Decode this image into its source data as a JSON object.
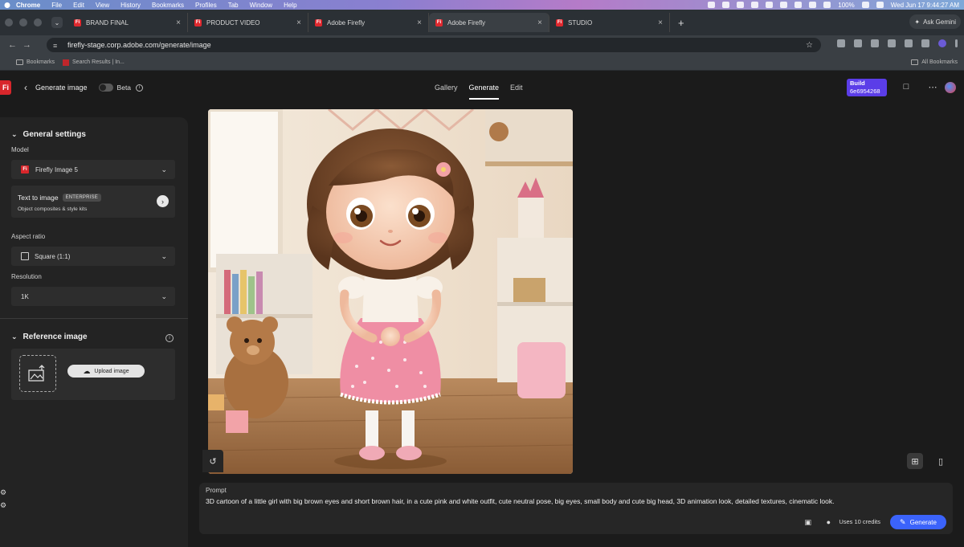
{
  "menubar": {
    "items": [
      "Chrome",
      "File",
      "Edit",
      "View",
      "History",
      "Bookmarks",
      "Profiles",
      "Tab",
      "Window",
      "Help"
    ],
    "battery": "100%",
    "clock": "Wed Jun 17  9:44:27 AM"
  },
  "tabs": [
    {
      "label": "BRAND FINAL"
    },
    {
      "label": "PRODUCT VIDEO"
    },
    {
      "label": "Adobe Firefly"
    },
    {
      "label": "Adobe Firefly"
    },
    {
      "label": "STUDIO"
    }
  ],
  "browser": {
    "ask_label": "Ask Gemini",
    "url": "firefly-stage.corp.adobe.com/generate/image",
    "bookmarks": {
      "folder": "Bookmarks",
      "search": "Search Results | In...",
      "all": "All Bookmarks"
    }
  },
  "header": {
    "logo": "Fi",
    "title": "Generate image",
    "beta": "Beta",
    "tabs": [
      "Gallery",
      "Generate",
      "Edit"
    ],
    "build_label": "Build",
    "build_id": "6e6954268"
  },
  "sidebar": {
    "general_title": "General settings",
    "model_label": "Model",
    "model_value": "Firefly Image 5",
    "card_title": "Text to image",
    "card_badge": "ENTERPRISE",
    "card_sub": "Object composites & style kits",
    "aspect_label": "Aspect ratio",
    "aspect_value": "Square (1:1)",
    "resolution_label": "Resolution",
    "resolution_value": "1K",
    "reference_title": "Reference image",
    "upload_label": "Upload image"
  },
  "prompt": {
    "label": "Prompt",
    "text": "3D cartoon of a little girl with big brown eyes and short brown hair, in a cute pink and white outfit, cute neutral pose, big eyes, small body and cute big head, 3D animation look, detailed textures, cinematic look.",
    "credits": "Uses 10 credits",
    "generate_label": "Generate"
  }
}
